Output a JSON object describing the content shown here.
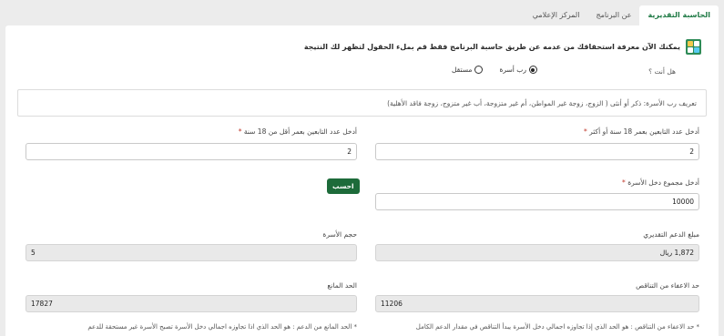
{
  "tabs": [
    {
      "label": "الحاسبة التقديرية",
      "active": true
    },
    {
      "label": "عن البرنامج",
      "active": false
    },
    {
      "label": "المركز الإعلامي",
      "active": false
    }
  ],
  "intro": "يمكنك الآن معرفة استحقاقك من عدمه عن طريق حاسبة البرنامج فقط قم بملء الحقول لتظهر لك النتيجة",
  "question": "هل أنت ؟",
  "radios": [
    {
      "label": "رب أسرة",
      "checked": true
    },
    {
      "label": "مستقل",
      "checked": false
    }
  ],
  "definition": "تعريف رب الأسرة: ذكر أو أنثى ( الزوج، زوجة غير المواطن، أم غير متزوجة، أب غير متزوج، زوجة فاقد الأهلية)",
  "fields": {
    "adults_label": "أدخل عدد التابعين بعمر 18 سنة أو أكثر",
    "adults_value": "2",
    "minors_label": "أدخل عدد التابعين بعمر أقل من 18 سنة",
    "minors_value": "2",
    "income_label": "أدخل مجموع دخل الأسرة",
    "income_value": "10000",
    "calc_button": "احسب",
    "support_label": "مبلغ الدعم التقديري",
    "support_value": "1,872 ريال",
    "family_size_label": "حجم الأسرة",
    "family_size_value": "5",
    "exemption_label": "حد الاعفاء من التناقص",
    "exemption_value": "11206",
    "cutoff_label": "الحد المانع",
    "cutoff_value": "17827"
  },
  "notes": {
    "exemption": "* حد الاعفاء من التناقص : هو الحد الذي إذا تجاوزه اجمالي دخل الأسرة يبدأ التناقص في مقدار الدعم الكامل",
    "cutoff": "* الحد المانع من الدعم : هو الحد الذي اذا تجاوزه اجمالي دخل الأسرة تصبح الأسرة غير مستحقة للدعم"
  },
  "colors": {
    "accent": "#1f7a45",
    "button": "#1d6b3a"
  },
  "icons": {
    "header": "calculator-icon"
  }
}
